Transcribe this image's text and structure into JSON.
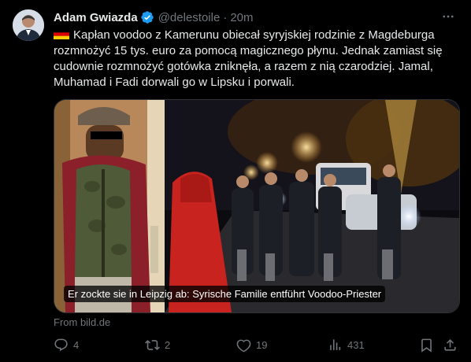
{
  "tweet": {
    "author": {
      "display_name": "Adam Gwiazda",
      "handle": "@delestoile",
      "verified": true,
      "avatar_icon": "user-avatar"
    },
    "separator": "·",
    "time": "20m",
    "more_icon": "more-horizontal-icon",
    "flag_icon": "germany-flag-icon",
    "text": "Kapłan voodoo z Kamerunu obiecał syryjskiej rodzinie z Magdeburga rozmnożyć 15 tys. euro za pomocą magicznego płynu. Jednak zamiast się cudownie rozmnożyć gotówka zniknęła, a razem z nią czarodziej. Jamal, Muhamad i Fadi dorwali go w Lipsku i porwali.",
    "card": {
      "caption": "Er zockte sie in Leipzig ab: Syrische Familie entführt Voodoo-Priester",
      "source": "From bild.de"
    },
    "actions": {
      "replies": "4",
      "reposts": "2",
      "likes": "19",
      "views": "431"
    }
  },
  "colors": {
    "background": "#000000",
    "text": "#e7e9ea",
    "secondary": "#71767b",
    "verified": "#1d9bf0"
  }
}
